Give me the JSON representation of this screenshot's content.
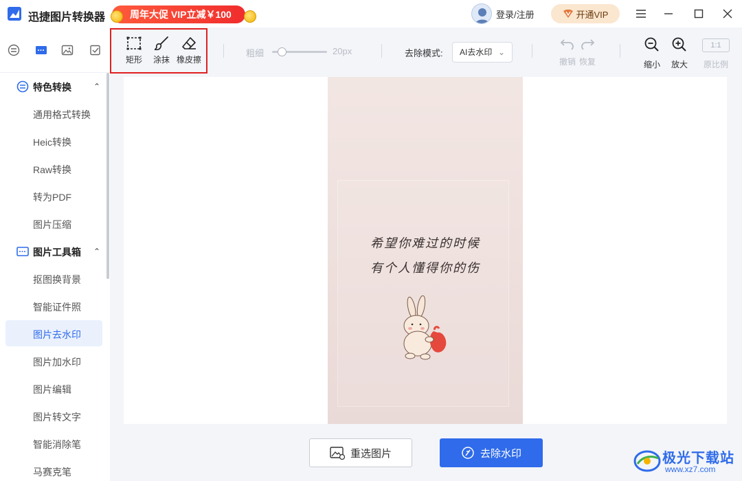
{
  "app": {
    "title": "迅捷图片转换器",
    "promo": "周年大促 VIP立减￥100"
  },
  "header": {
    "login": "登录/注册",
    "vip": "开通VIP"
  },
  "sidebar": {
    "groups": [
      {
        "label": "特色转换",
        "items": [
          "通用格式转换",
          "Heic转换",
          "Raw转换",
          "转为PDF",
          "图片压缩"
        ]
      },
      {
        "label": "图片工具箱",
        "items": [
          "抠图换背景",
          "智能证件照",
          "图片去水印",
          "图片加水印",
          "图片编辑",
          "图片转文字",
          "智能消除笔",
          "马赛克笔"
        ]
      }
    ],
    "active": "图片去水印"
  },
  "toolbar": {
    "tools": [
      "矩形",
      "涂抹",
      "橡皮擦"
    ],
    "thickness_label": "粗细",
    "thickness_value": "20px",
    "mode_label": "去除模式:",
    "mode_value": "AI去水印",
    "undo": "撤销",
    "redo": "恢复",
    "zoom_out": "缩小",
    "zoom_in": "放大",
    "ratio_box": "1:1",
    "ratio_label": "原比例"
  },
  "image": {
    "line1": "希望你难过的时候",
    "line2": "有个人懂得你的伤"
  },
  "actions": {
    "reselect": "重选图片",
    "remove": "去除水印"
  },
  "watermark": {
    "name": "极光下载站",
    "url": "www.xz7.com"
  },
  "colors": {
    "accent": "#2f6bea",
    "promo": "#f02d2d",
    "highlight": "#e02020"
  }
}
